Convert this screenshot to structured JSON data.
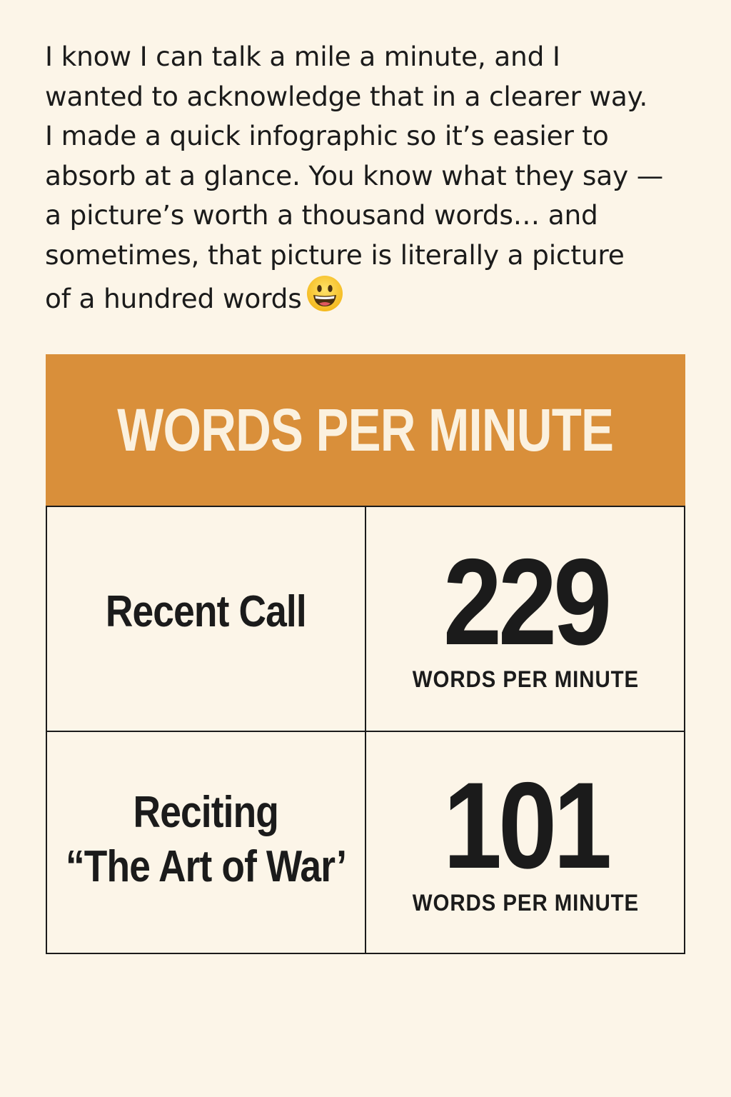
{
  "intro": {
    "line1": "I know I can talk a mile a minute, and I",
    "line2": "wanted to acknowledge that in a clearer way.",
    "line3": "I made a quick infographic so it’s easier to",
    "line4": "absorb at a glance. You know what they say —",
    "line5": "a picture’s worth a thousand words… and",
    "line6": "sometimes, that picture is literally a picture",
    "line7": "of a hundred words",
    "emoji_icon": "grinning-face-emoji"
  },
  "infographic": {
    "title": "WORDS PER MINUTE",
    "header_color": "#d98f3a",
    "rows": [
      {
        "label_line1": "Recent Call",
        "label_line2": "",
        "value": "229",
        "unit": "WORDS PER MINUTE"
      },
      {
        "label_line1": "Reciting",
        "label_line2": "“The Art of War’",
        "value": "101",
        "unit": "WORDS PER MINUTE"
      }
    ]
  }
}
